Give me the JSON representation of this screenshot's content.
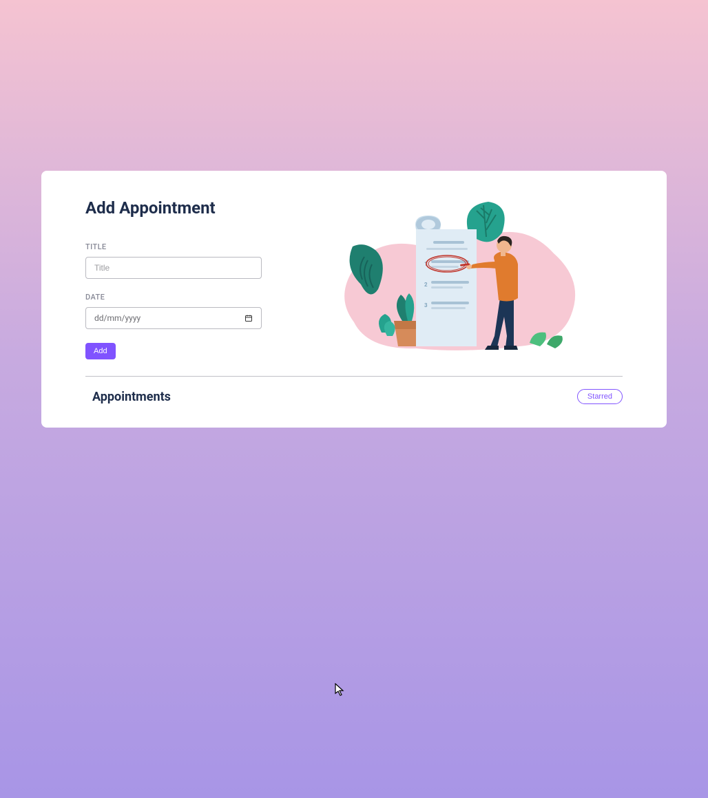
{
  "form": {
    "heading": "Add Appointment",
    "title_label": "TITLE",
    "title_placeholder": "Title",
    "date_label": "DATE",
    "date_placeholder": "dd/mm/yyyy",
    "add_button": "Add"
  },
  "appointments": {
    "heading": "Appointments",
    "starred_button": "Starred"
  },
  "colors": {
    "accent": "#8053ff",
    "heading_text": "#1e2d4b",
    "label_text": "#888a97",
    "border": "#b9b9c0"
  }
}
